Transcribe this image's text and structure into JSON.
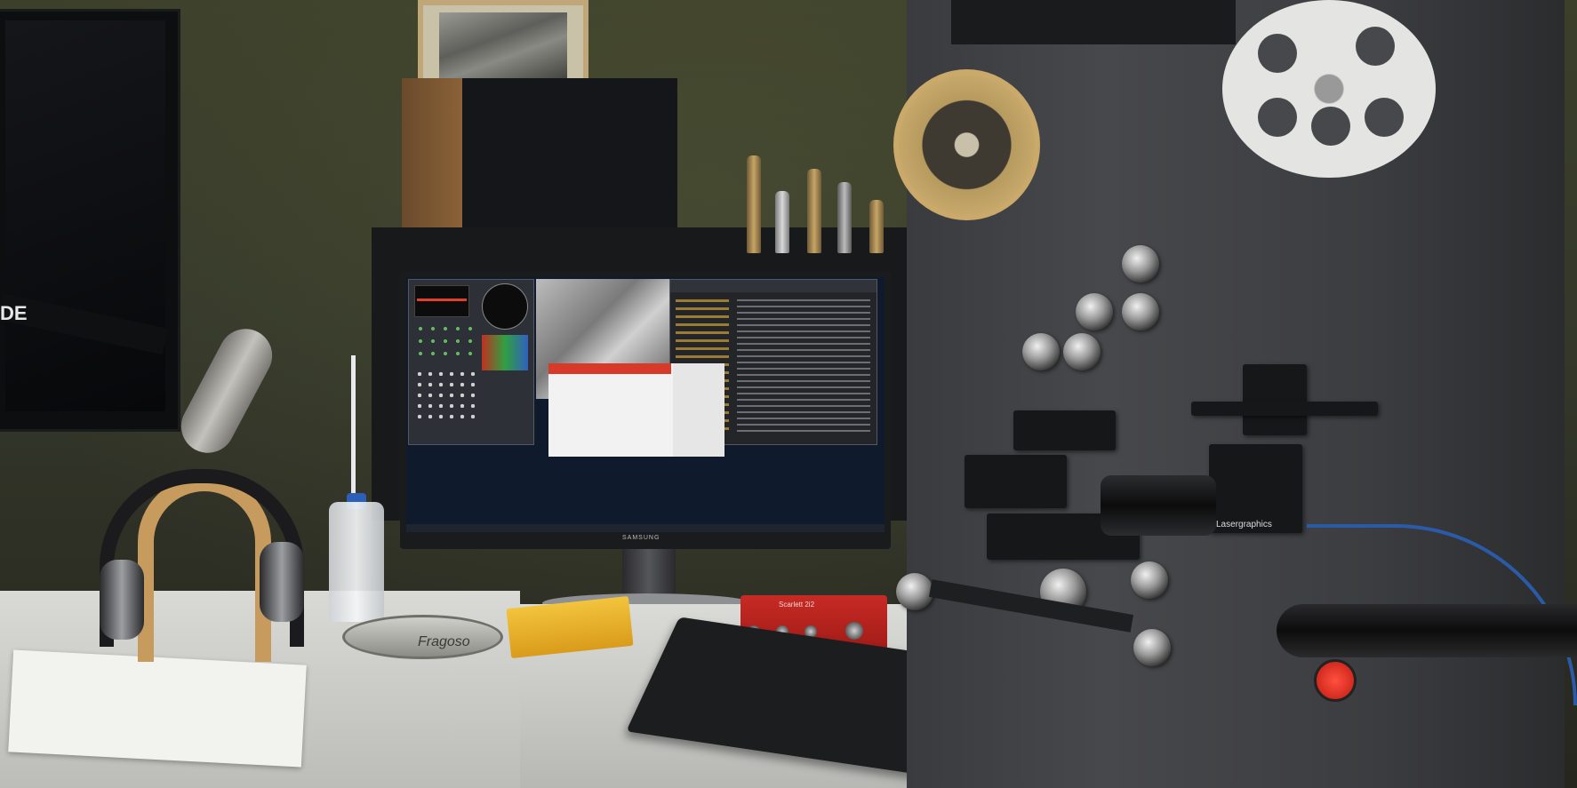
{
  "scene": {
    "tv_label": "DE",
    "monitor_brand": "SAMSUNG",
    "audio_interface_label": "Scarlett 2i2",
    "reel_can_label": "Fragoso",
    "scanner_brand": "Lasergraphics"
  },
  "colors": {
    "wall": "#3c3f2a",
    "desk": "#d9dad6",
    "scanner": "#47484b",
    "audio_interface": "#c82a24",
    "film_box": "#f3c43d",
    "cable": "#2a5aa8",
    "stop_button": "#ff5040"
  },
  "icons": [
    "microphone-icon",
    "headphones-icon",
    "film-reel-icon",
    "keyboard-icon",
    "mouse-icon",
    "stop-button-icon"
  ]
}
